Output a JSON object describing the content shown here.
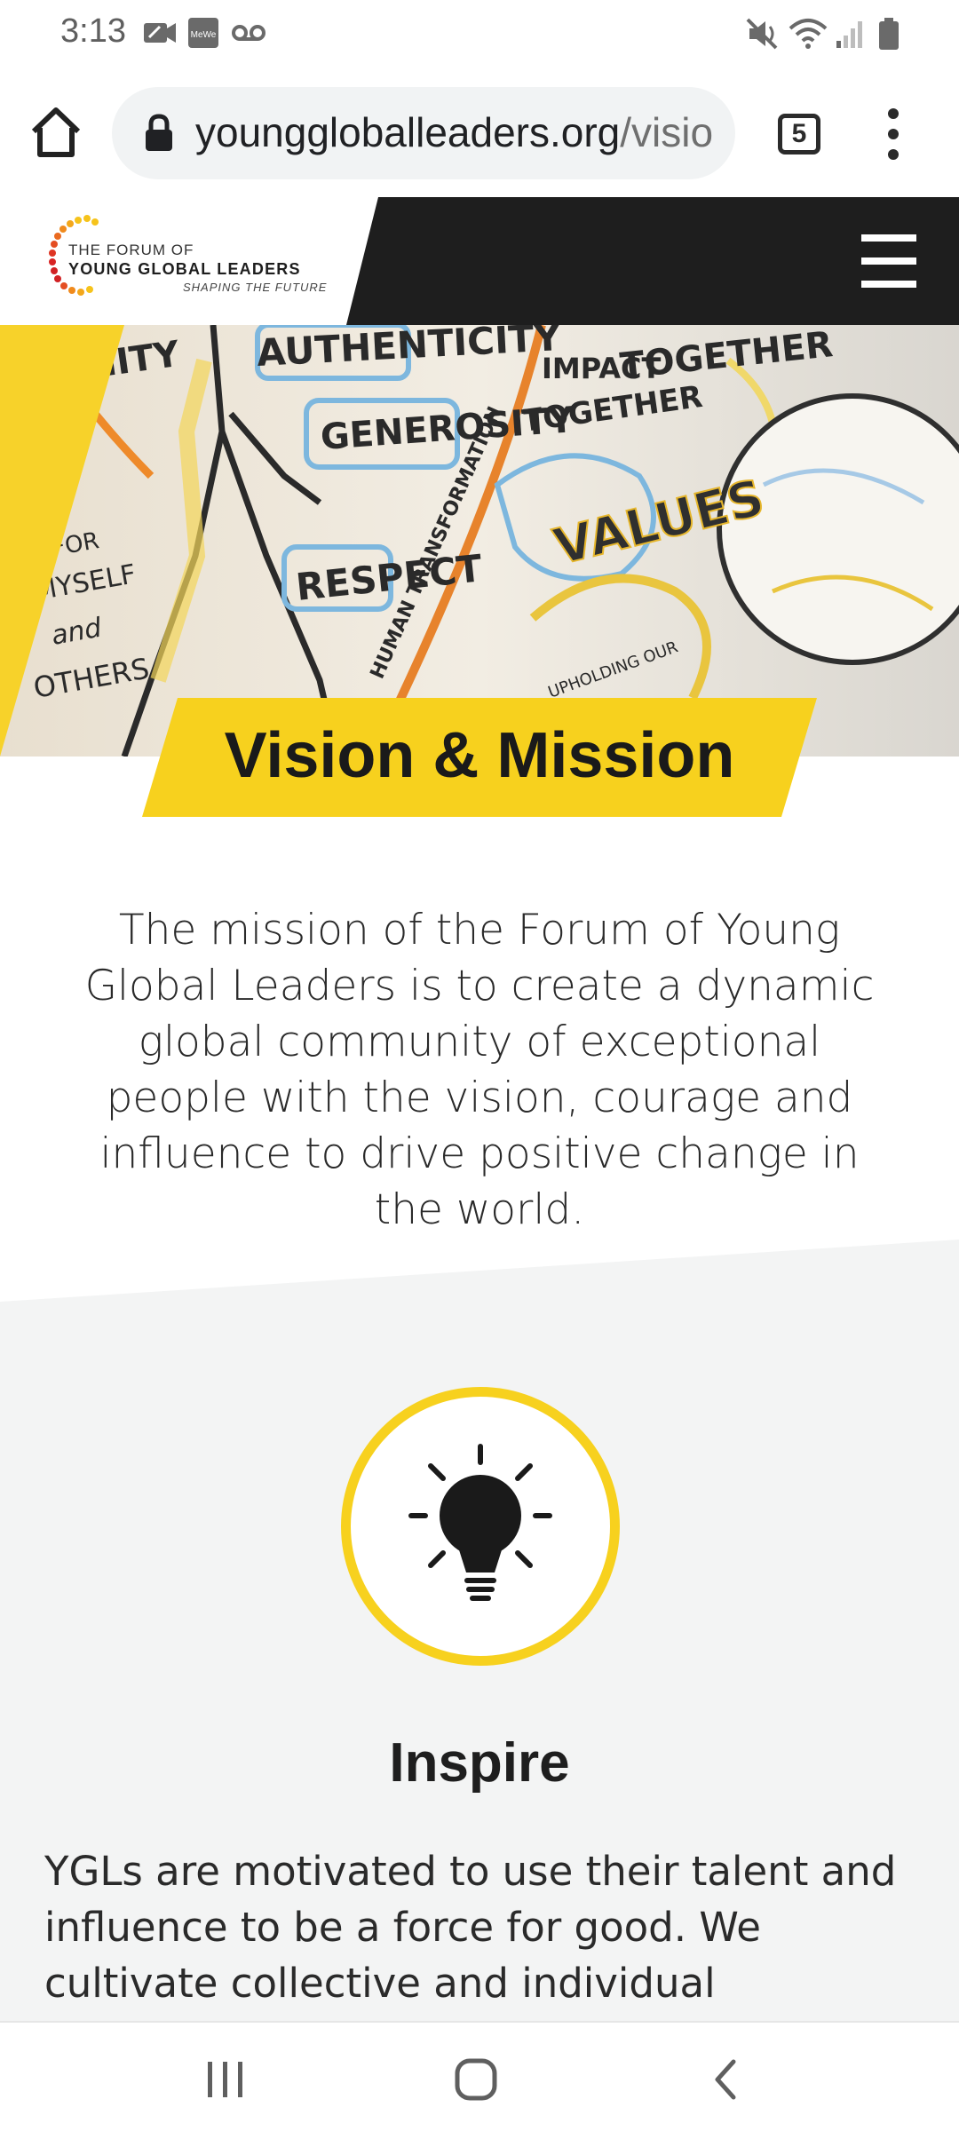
{
  "status_bar": {
    "time": "3:13",
    "left_icons": [
      "video-call-icon",
      "mewe-icon",
      "voicemail-icon"
    ],
    "right_icons": [
      "mute-icon",
      "wifi-icon",
      "signal-icon",
      "battery-icon"
    ]
  },
  "browser": {
    "url": "younggloballeaders.org/visio",
    "url_host": "younggloballeaders.org",
    "url_path": "/visio",
    "tab_count": "5"
  },
  "site": {
    "logo": {
      "line1": "THE FORUM OF",
      "line2": "YOUNG GLOBAL LEADERS",
      "line3": "SHAPING THE FUTURE"
    }
  },
  "hero": {
    "title": "Vision & Mission",
    "image_words": [
      "AUTHENTICITY",
      "GENEROSITY",
      "RESPECT",
      "IMPACT",
      "TOGETHER",
      "VALUES",
      "HUMAN TRANSFORMATION",
      "FOR MYSELF and OTHERS"
    ]
  },
  "mission": {
    "text": "The mission of the Forum of Young Global Leaders is to create a dynamic global community of exceptional people with the vision, courage and influence to drive positive change in the world."
  },
  "inspire": {
    "icon": "lightbulb-icon",
    "title": "Inspire",
    "body": "YGLs are motivated to use their talent and influence to be a force for good. We cultivate collective and individual leadership to help"
  },
  "colors": {
    "accent_yellow": "#f7d11e",
    "header_dark": "#1e1e1e",
    "section_grey": "#f3f4f4"
  },
  "nav": {
    "buttons": [
      "recent-apps",
      "home",
      "back"
    ]
  }
}
